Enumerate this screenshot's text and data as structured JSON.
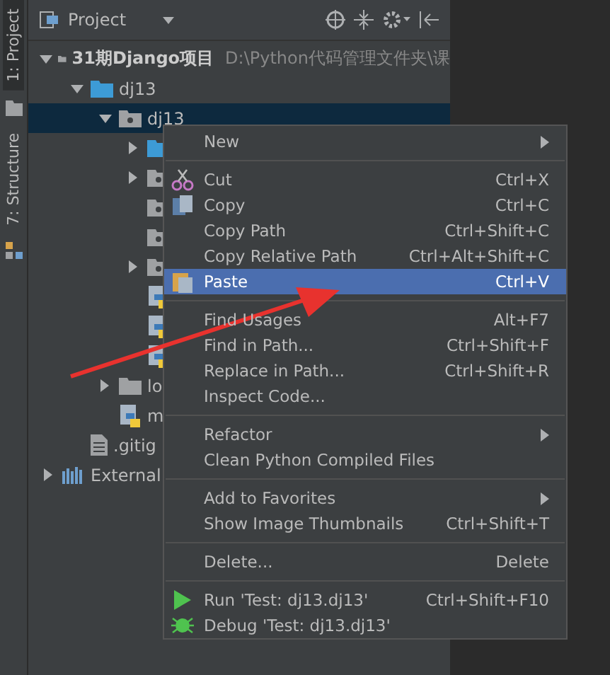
{
  "tool_strip": [
    {
      "label": "1: Project",
      "selected": true
    },
    {
      "label": "7: Structure",
      "selected": false
    }
  ],
  "project_panel": {
    "title": "Project",
    "tree": [
      {
        "kind": "root",
        "label": "31期Django项目",
        "path": "D:\\Python代码管理文件夹\\课",
        "expanded": true,
        "selected": false,
        "children": [
          {
            "kind": "source",
            "label": "dj13",
            "expanded": true,
            "selected": false,
            "children": [
              {
                "kind": "package",
                "label": "dj13",
                "expanded": true,
                "selected": true,
                "children": [
                  {
                    "kind": "source",
                    "expanded": false,
                    "selected": false
                  },
                  {
                    "kind": "package",
                    "expanded": false,
                    "selected": false
                  },
                  {
                    "kind": "package",
                    "selected": false
                  },
                  {
                    "kind": "package",
                    "selected": false
                  },
                  {
                    "kind": "package",
                    "expanded": false,
                    "selected": false
                  },
                  {
                    "kind": "python",
                    "selected": false
                  },
                  {
                    "kind": "python",
                    "selected": false
                  },
                  {
                    "kind": "python",
                    "selected": false
                  }
                ]
              },
              {
                "kind": "folder",
                "label": "lo",
                "expanded": false,
                "selected": false
              },
              {
                "kind": "python",
                "label": "m",
                "selected": false
              }
            ]
          },
          {
            "kind": "file",
            "label": ".gitig",
            "selected": false
          }
        ]
      },
      {
        "kind": "library",
        "label": "External",
        "expanded": false,
        "selected": false
      }
    ]
  },
  "context_menu": {
    "groups": [
      [
        {
          "label": "New",
          "submenu": true,
          "selected": false
        }
      ],
      [
        {
          "label": "Cut",
          "shortcut": "Ctrl+X",
          "selected": false
        },
        {
          "label": "Copy",
          "shortcut": "Ctrl+C",
          "selected": false
        },
        {
          "label": "Copy Path",
          "shortcut": "Ctrl+Shift+C",
          "selected": false
        },
        {
          "label": "Copy Relative Path",
          "shortcut": "Ctrl+Alt+Shift+C",
          "selected": false
        },
        {
          "label": "Paste",
          "shortcut": "Ctrl+V",
          "selected": true
        }
      ],
      [
        {
          "label": "Find Usages",
          "shortcut": "Alt+F7",
          "selected": false
        },
        {
          "label": "Find in Path...",
          "shortcut": "Ctrl+Shift+F",
          "selected": false
        },
        {
          "label": "Replace in Path...",
          "shortcut": "Ctrl+Shift+R",
          "selected": false
        },
        {
          "label": "Inspect Code...",
          "selected": false
        }
      ],
      [
        {
          "label": "Refactor",
          "submenu": true,
          "selected": false
        },
        {
          "label": "Clean Python Compiled Files",
          "selected": false
        }
      ],
      [
        {
          "label": "Add to Favorites",
          "submenu": true,
          "selected": false
        },
        {
          "label": "Show Image Thumbnails",
          "shortcut": "Ctrl+Shift+T",
          "selected": false
        }
      ],
      [
        {
          "label": "Delete...",
          "shortcut": "Delete",
          "selected": false
        }
      ],
      [
        {
          "label": "Run 'Test: dj13.dj13'",
          "shortcut": "Ctrl+Shift+F10",
          "selected": false
        },
        {
          "label": "Debug 'Test: dj13.dj13'",
          "selected": false
        }
      ]
    ]
  }
}
